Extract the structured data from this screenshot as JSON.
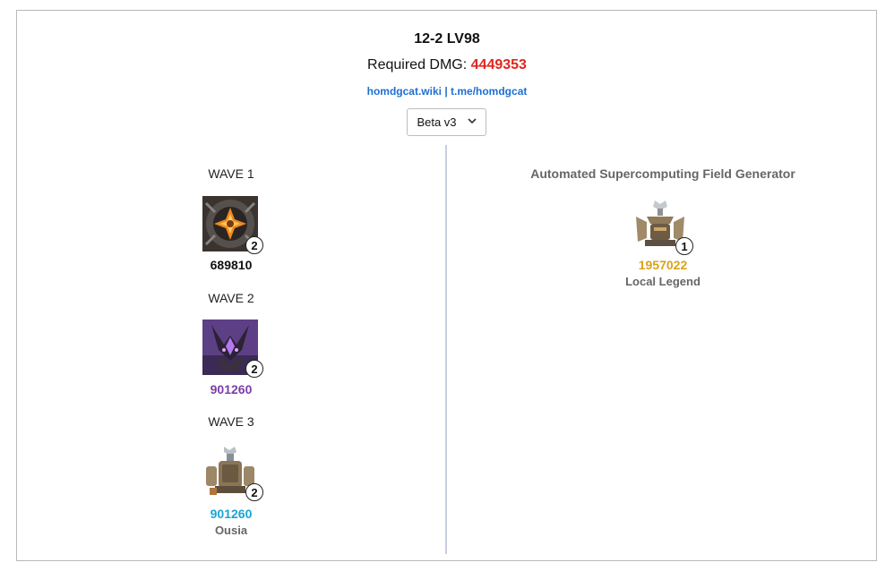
{
  "header": {
    "title": "12-2 LV98",
    "required_label": "Required DMG:",
    "required_value": "4449353",
    "required_color": "#e0261d",
    "link_site": "homdgcat.wiki",
    "link_separator": " | ",
    "link_tg": "t.me/homdgcat"
  },
  "version_select": {
    "value": "Beta v3",
    "icon": "chevron-down-icon"
  },
  "waves": [
    {
      "title": "WAVE 1",
      "count": "2",
      "hp": "689810",
      "hp_color": "#111111",
      "icon": "orange-cross-emblem-icon"
    },
    {
      "title": "WAVE 2",
      "count": "2",
      "hp": "901260",
      "hp_color": "#7b3fa8",
      "icon": "purple-horned-beast-icon"
    },
    {
      "title": "WAVE 3",
      "count": "2",
      "hp": "901260",
      "hp_color": "#1aa3d6",
      "name": "Ousia",
      "icon": "mechanical-robot-icon"
    }
  ],
  "boss": {
    "title": "Automated Supercomputing Field Generator",
    "count": "1",
    "hp": "1957022",
    "hp_color": "#d9a21b",
    "name": "Local Legend",
    "icon": "field-generator-robot-icon"
  }
}
